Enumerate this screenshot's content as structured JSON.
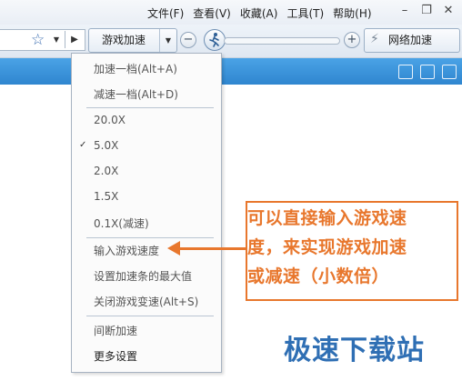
{
  "menubar": {
    "items": [
      "文件(F)",
      "查看(V)",
      "收藏(A)",
      "工具(T)",
      "帮助(H)"
    ]
  },
  "toolbar": {
    "speed_label": "游戏加速",
    "net_label": "网络加速"
  },
  "dropdown": {
    "items": [
      "加速一档(Alt+A)",
      "减速一档(Alt+D)",
      "20.0X",
      "5.0X",
      "2.0X",
      "1.5X",
      "0.1X(减速)",
      "输入游戏速度",
      "设置加速条的最大值",
      "关闭游戏变速(Alt+S)",
      "间断加速",
      "更多设置"
    ],
    "checked": "5.0X"
  },
  "annotation": {
    "lines": [
      "可以直接输入游戏速",
      "度，来实现游戏加速",
      "或减速（小数倍）"
    ]
  },
  "watermark": "极速下载站",
  "colors": {
    "accent_orange": "#e8772d",
    "tab_blue": "#2f86cf",
    "watermark_blue": "#2f6fb4"
  }
}
